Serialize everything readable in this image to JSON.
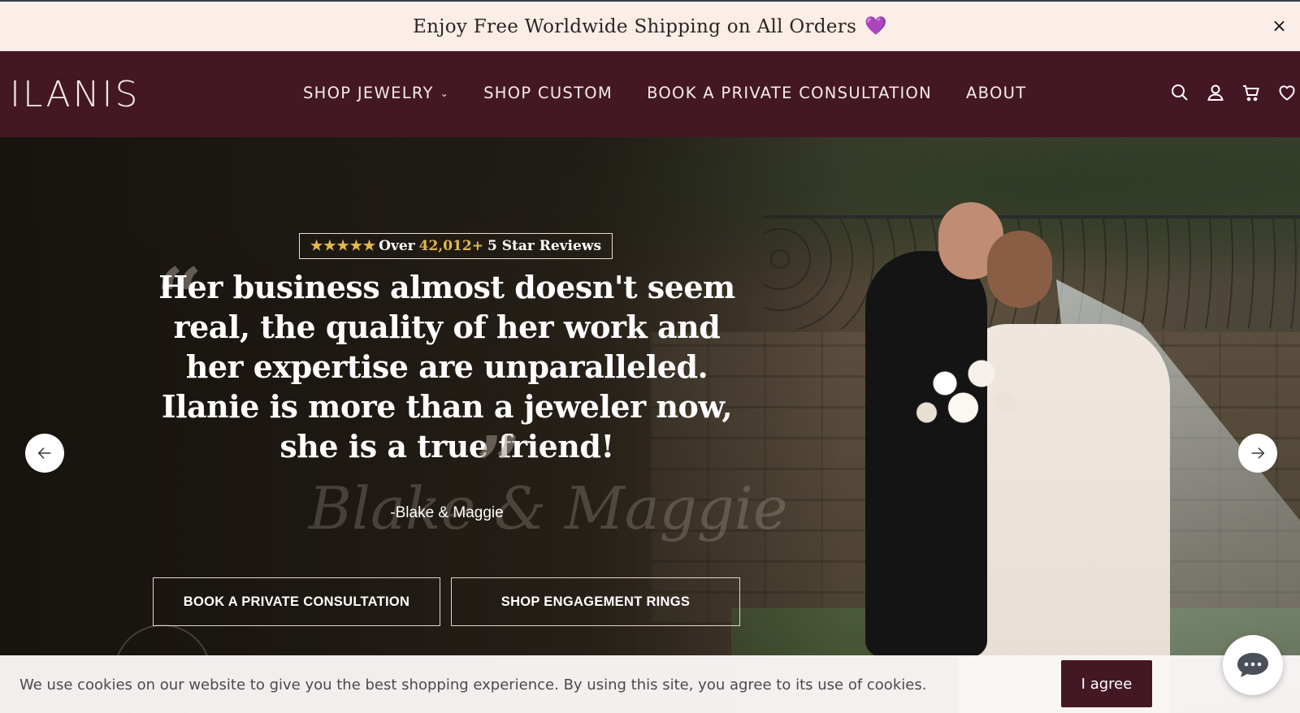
{
  "announcement": {
    "text": "Enjoy Free Worldwide Shipping on All Orders",
    "heart_icon": "heart-emoji-icon",
    "close_label": "×"
  },
  "header": {
    "logo": "ILANIS",
    "nav": [
      {
        "label": "SHOP JEWELRY",
        "has_dropdown": true
      },
      {
        "label": "SHOP CUSTOM"
      },
      {
        "label": "BOOK A PRIVATE CONSULTATION"
      },
      {
        "label": "ABOUT"
      }
    ],
    "icons": [
      "search-icon",
      "account-icon",
      "cart-icon",
      "wishlist-icon"
    ]
  },
  "hero": {
    "badge": {
      "stars": "★★★★★",
      "prefix": "Over",
      "count": "42,012+",
      "suffix": "5 Star Reviews"
    },
    "quote": "Her business almost doesn't seem real, the quality of her work and her expertise are unparalleled. Ilanie is more than a jeweler now, she is a true friend!",
    "signature": "Blake & Maggie",
    "author": "-Blake & Maggie",
    "buttons": {
      "consult": "BOOK A PRIVATE CONSULTATION",
      "rings": "SHOP ENGAGEMENT RINGS"
    }
  },
  "cookie": {
    "message": "We use cookies on our website to give you the best shopping experience. By using this site, you agree to its use of cookies.",
    "agree_label": "I agree"
  },
  "colors": {
    "header_bg": "#441724",
    "announce_bg": "#fbeee8",
    "star_gold": "#e6b84c"
  }
}
